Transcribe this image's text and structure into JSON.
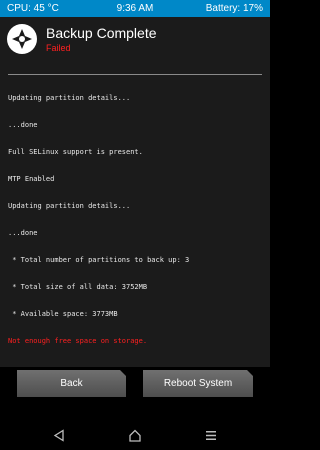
{
  "status_bar": {
    "cpu": "CPU: 45 °C",
    "time": "9:36 AM",
    "battery": "Battery: 17%"
  },
  "header": {
    "title": "Backup Complete",
    "subtitle": "Failed",
    "logo_icon": "twrp-logo-icon"
  },
  "console": {
    "lines": [
      "Updating partition details...",
      "...done",
      "Full SELinux support is present.",
      "MTP Enabled",
      "Updating partition details...",
      "...done",
      " * Total number of partitions to back up: 3",
      " * Total size of all data: 3752MB",
      " * Available space: 3773MB"
    ],
    "error": "Not enough free space on storage."
  },
  "buttons": {
    "back": "Back",
    "reboot": "Reboot System"
  },
  "nav": {
    "back_icon": "back-triangle-icon",
    "home_icon": "home-icon",
    "menu_icon": "menu-icon"
  },
  "colors": {
    "status_bar": "#0088c8",
    "error": "#ff2020",
    "panel": "#1b1b1b"
  }
}
